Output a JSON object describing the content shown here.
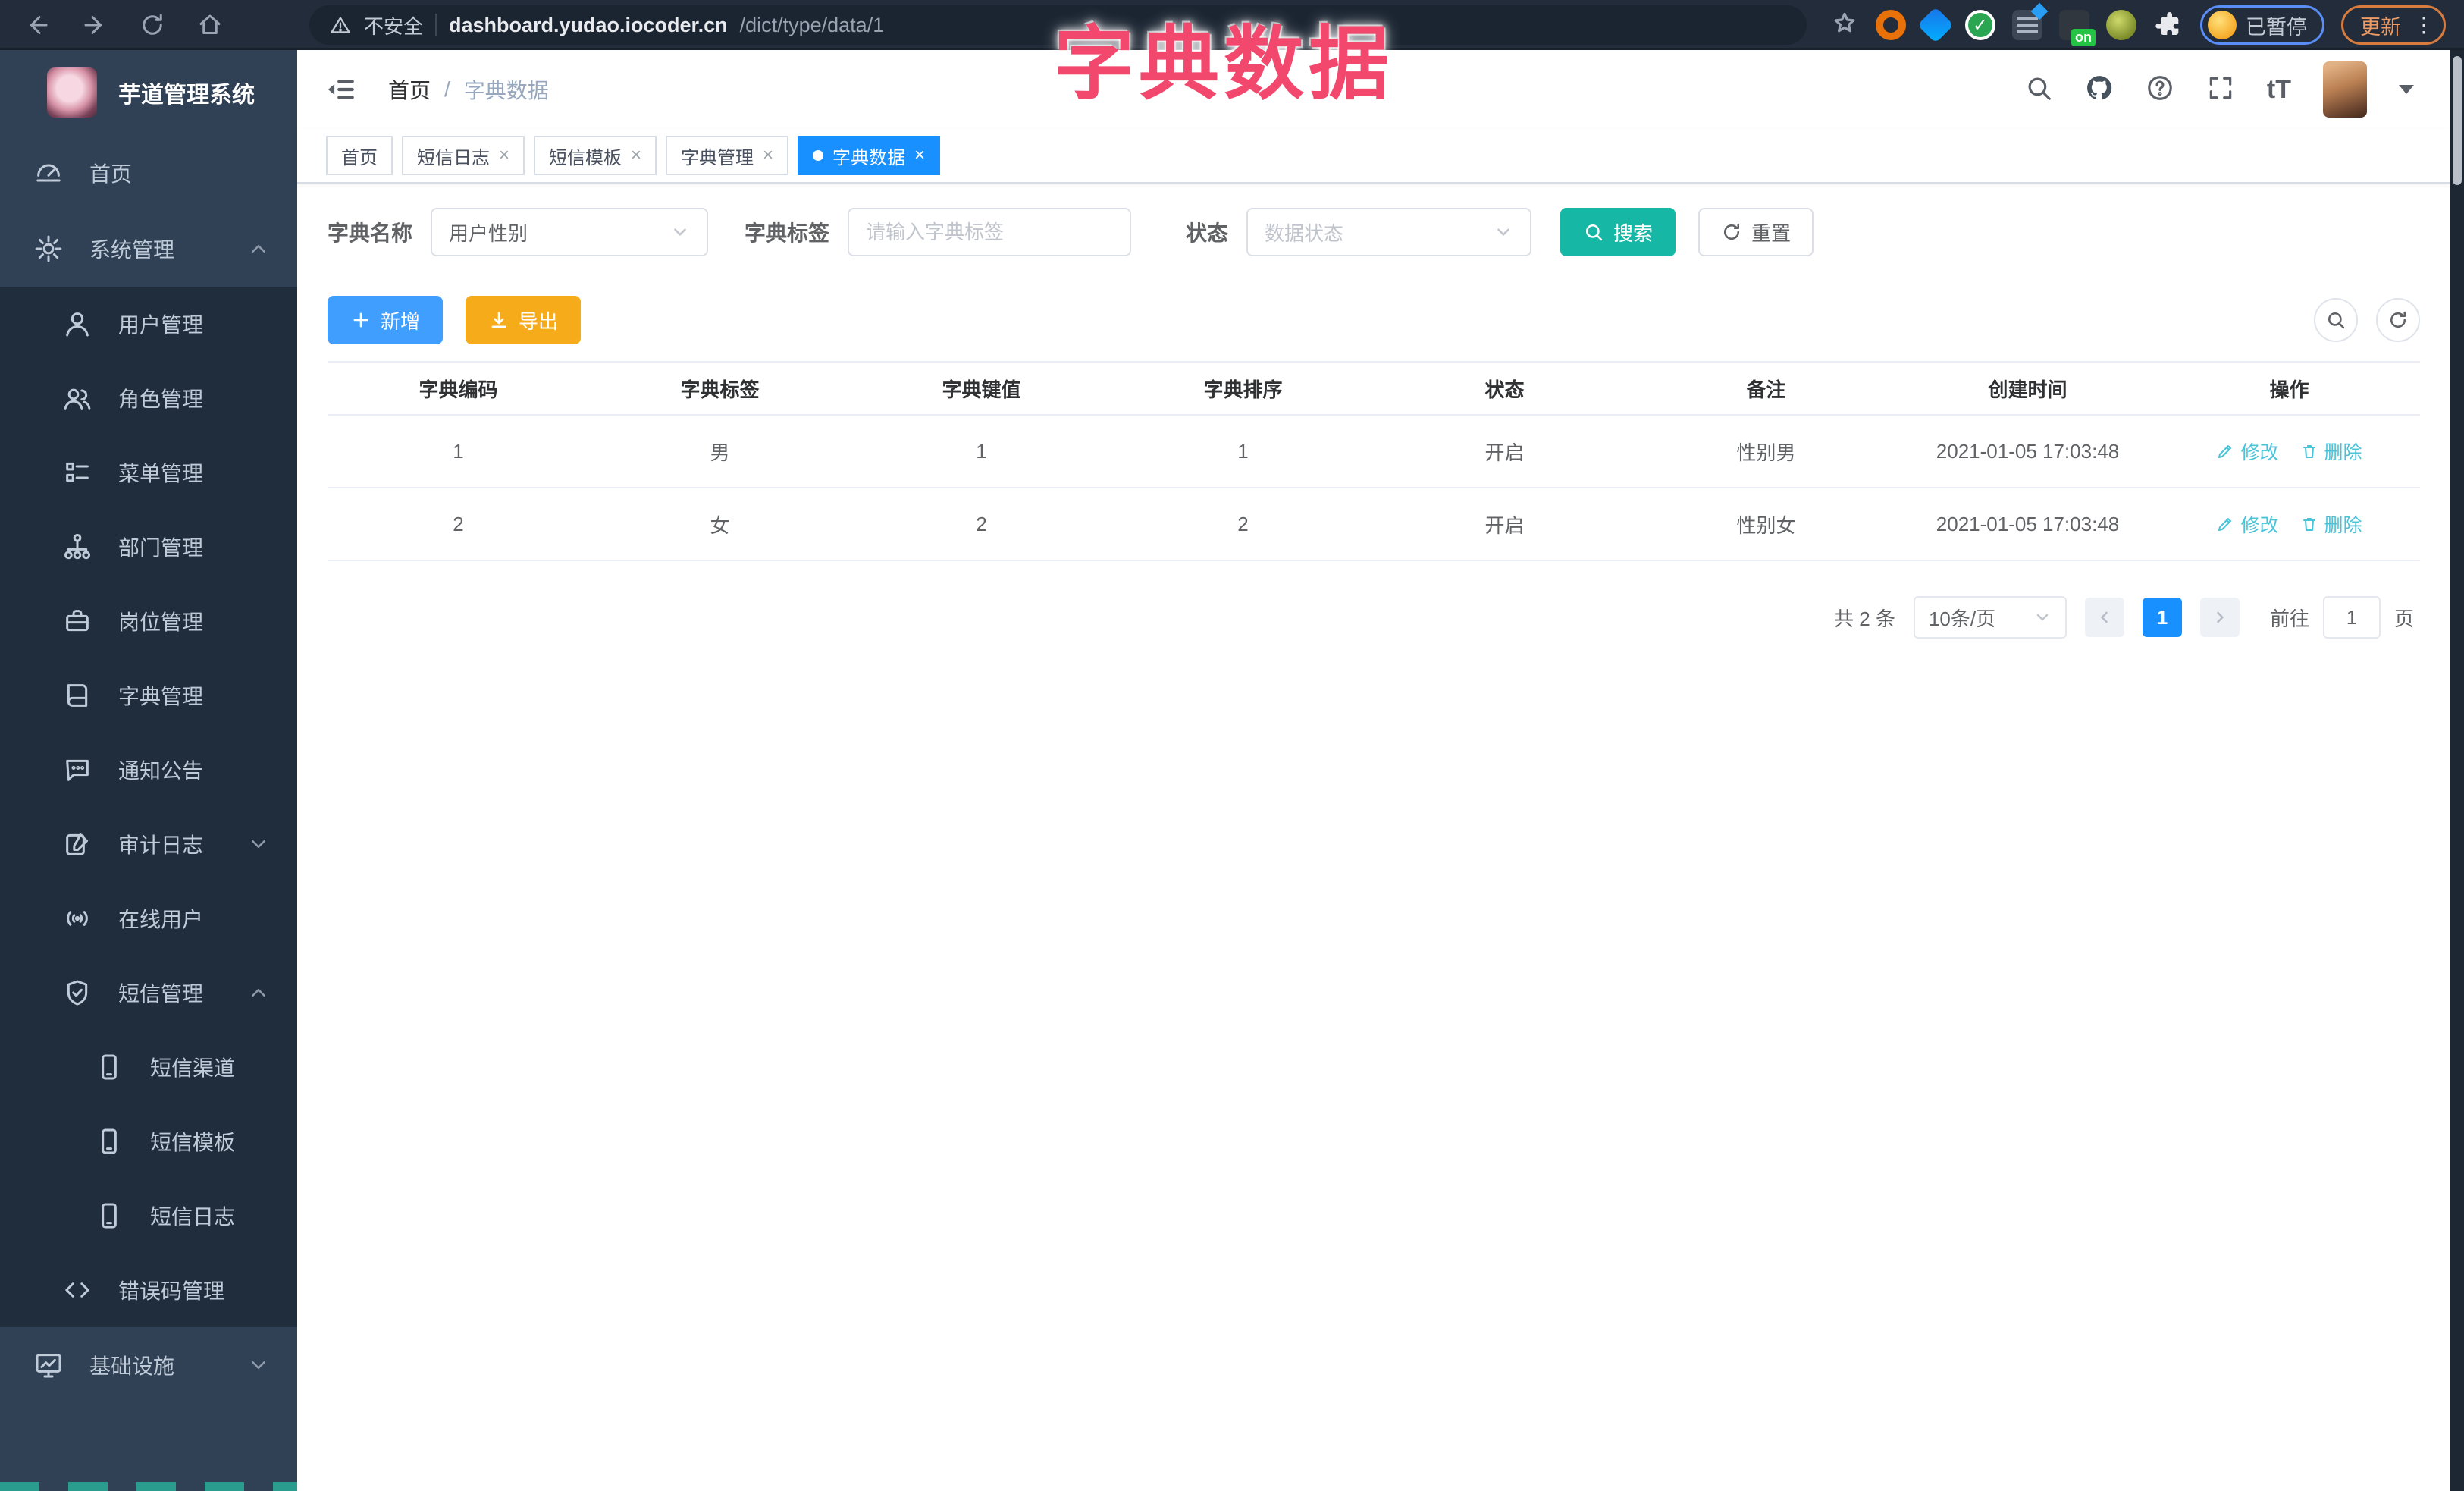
{
  "browser": {
    "security_label": "不安全",
    "url_host": "dashboard.yudao.iocoder.cn",
    "url_path": "/dict/type/data/1",
    "paused_label": "已暂停",
    "update_label": "更新",
    "extension_on_badge": "on",
    "extension_check_glyph": "✓"
  },
  "overlay_title": "字典数据",
  "sidebar": {
    "app_title": "芋道管理系统",
    "items": [
      {
        "label": "首页",
        "icon": "dashboard-icon",
        "level": 1
      },
      {
        "label": "系统管理",
        "icon": "gear-icon",
        "level": 1,
        "arrow": "up"
      },
      {
        "label": "用户管理",
        "icon": "user-icon",
        "level": 2
      },
      {
        "label": "角色管理",
        "icon": "users-icon",
        "level": 2
      },
      {
        "label": "菜单管理",
        "icon": "menu-list-icon",
        "level": 2
      },
      {
        "label": "部门管理",
        "icon": "org-tree-icon",
        "level": 2
      },
      {
        "label": "岗位管理",
        "icon": "briefcase-icon",
        "level": 2
      },
      {
        "label": "字典管理",
        "icon": "book-icon",
        "level": 2
      },
      {
        "label": "通知公告",
        "icon": "message-icon",
        "level": 2
      },
      {
        "label": "审计日志",
        "icon": "audit-log-icon",
        "level": 2,
        "arrow": "down"
      },
      {
        "label": "在线用户",
        "icon": "online-icon",
        "level": 2
      },
      {
        "label": "短信管理",
        "icon": "shield-check-icon",
        "level": 2,
        "arrow": "up"
      },
      {
        "label": "短信渠道",
        "icon": "phone-icon",
        "level": 3
      },
      {
        "label": "短信模板",
        "icon": "phone-icon",
        "level": 3
      },
      {
        "label": "短信日志",
        "icon": "phone-icon",
        "level": 3
      },
      {
        "label": "错误码管理",
        "icon": "code-icon",
        "level": 2
      },
      {
        "label": "基础设施",
        "icon": "monitor-icon",
        "level": 1,
        "arrow": "down"
      }
    ]
  },
  "header": {
    "breadcrumb_home": "首页",
    "breadcrumb_separator": "/",
    "breadcrumb_current": "字典数据",
    "font_size_icon_text": "tT"
  },
  "tabs": [
    {
      "label": "首页"
    },
    {
      "label": "短信日志"
    },
    {
      "label": "短信模板"
    },
    {
      "label": "字典管理"
    },
    {
      "label": "字典数据"
    }
  ],
  "tab_close_glyph": "×",
  "filters": {
    "name_label": "字典名称",
    "name_value": "用户性别",
    "tag_label": "字典标签",
    "tag_placeholder": "请输入字典标签",
    "status_label": "状态",
    "status_placeholder": "数据状态",
    "search_label": "搜索",
    "reset_label": "重置"
  },
  "toolbar": {
    "add_label": "新增",
    "export_label": "导出"
  },
  "table": {
    "headers": [
      "字典编码",
      "字典标签",
      "字典键值",
      "字典排序",
      "状态",
      "备注",
      "创建时间",
      "操作"
    ],
    "rows": [
      {
        "code": "1",
        "label": "男",
        "value": "1",
        "sort": "1",
        "status": "开启",
        "remark": "性别男",
        "created": "2021-01-05 17:03:48"
      },
      {
        "code": "2",
        "label": "女",
        "value": "2",
        "sort": "2",
        "status": "开启",
        "remark": "性别女",
        "created": "2021-01-05 17:03:48"
      }
    ],
    "edit_label": "修改",
    "delete_label": "删除"
  },
  "pagination": {
    "total_label": "共 2 条",
    "page_size_value": "10条/页",
    "current_page": "1",
    "goto_label": "前往",
    "goto_value": "1",
    "page_unit": "页"
  },
  "colors": {
    "accent_blue": "#1890ff",
    "primary_button_blue": "#409eff",
    "search_button_teal": "#16b7a5",
    "export_button_amber": "#f6ab1a",
    "action_link_teal": "#49c3d8",
    "sidebar_bg": "#304156",
    "submenu_bg": "#1f2d3d",
    "overlay_pink": "#f2486d",
    "update_chip_orange": "#d77b3f",
    "paused_chip_blue": "#5a8df5"
  }
}
